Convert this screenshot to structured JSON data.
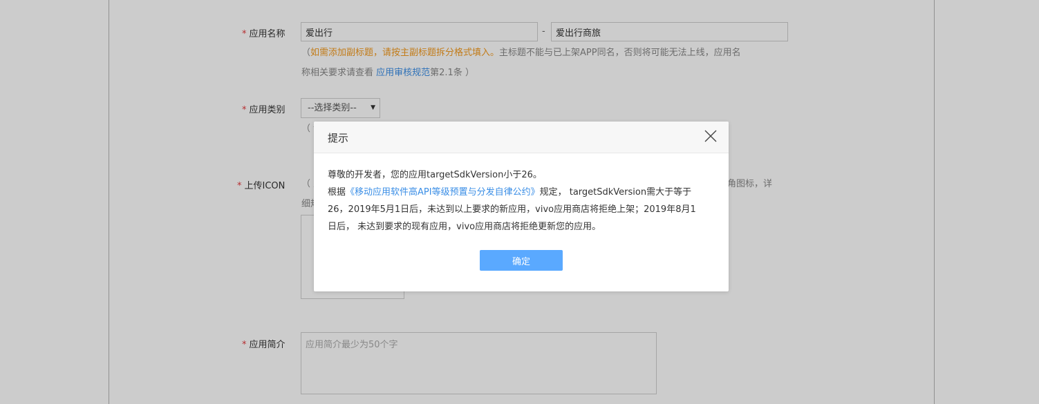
{
  "form": {
    "app_name": {
      "required_mark": "*",
      "label": "应用名称",
      "main_title_value": "爱出行",
      "separator": "-",
      "subtitle_value": "爱出行商旅",
      "hint_open": "（",
      "hint_warning": "如需添加副标题，请按主副标题拆分格式填入。",
      "hint_text": "主标题不能与已上架APP同名，否则将可能无法上线，应用名",
      "hint_line2_prefix": "称相关要求请查看 ",
      "hint_link": "应用审核规范",
      "hint_line2_suffix": "第2.1条 ）"
    },
    "app_category": {
      "required_mark": "*",
      "label": "应用类别",
      "select_value": "--选择类别--",
      "hint_partial": "（ 详"
    },
    "icon": {
      "required_mark": "*",
      "label": "上传ICON",
      "hint_partial_start": "（ 支",
      "hint_partial_end": "角图标，详",
      "hint_line2_partial": "细规"
    },
    "intro": {
      "required_mark": "*",
      "label": "应用简介",
      "placeholder": "应用简介最少为50个字"
    }
  },
  "modal": {
    "title": "提示",
    "line1": "尊敬的开发者，您的应用targetSdkVersion小于26。",
    "line2_prefix": "根据",
    "line2_link": "《移动应用软件高API等级预置与分发自律公约》",
    "line2_suffix": "规定， targetSdkVersion需大于等于",
    "line3": "26，2019年5月1日后，未达到以上要求的新应用，vivo应用商店将拒绝上架；2019年8月1",
    "line4": "日后， 未达到要求的现有应用，vivo应用商店将拒绝更新您的应用。",
    "ok_label": "确定",
    "close_icon": "close-icon"
  },
  "colors": {
    "required": "#e4393c",
    "warning": "#f39a1e",
    "link": "#3a8ee6",
    "primary_button": "#5aa9ff",
    "overlay": "rgba(0,0,0,0.2)"
  }
}
